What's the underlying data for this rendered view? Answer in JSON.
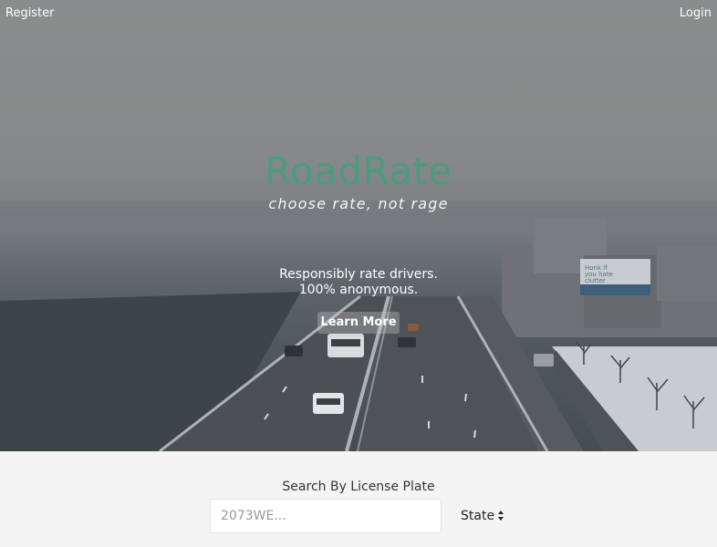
{
  "nav": {
    "register_label": "Register",
    "login_label": "Login"
  },
  "hero": {
    "brand": "RoadRate",
    "tagline": "choose rate, not rage",
    "pitch_line1": "Responsibly rate drivers.",
    "pitch_line2": "100% anonymous.",
    "learn_more_label": "Learn More",
    "billboard_line1": "Honk if",
    "billboard_line2": "you hate",
    "billboard_line3": "clutter"
  },
  "search": {
    "title": "Search By License Plate",
    "plate_placeholder": "2073WE...",
    "plate_value": "",
    "state_label": "State"
  },
  "colors": {
    "brand": "#4c9a80",
    "page_bg": "#f4f4f4",
    "hero_bg": "#7b7f81"
  }
}
